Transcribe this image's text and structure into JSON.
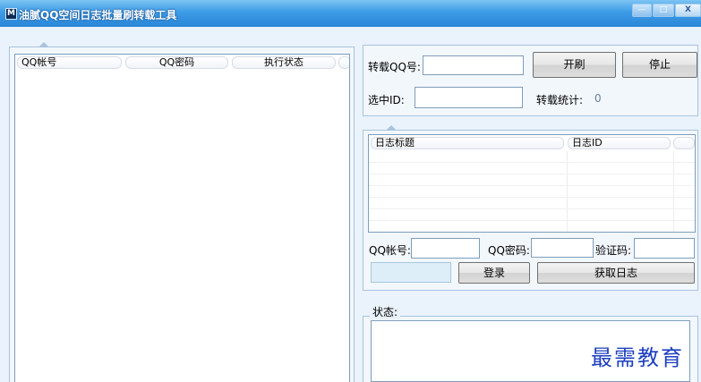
{
  "window": {
    "title": "油腻QQ空间日志批量刷转载工具",
    "app_icon": "M",
    "minimize_glyph": "—",
    "maximize_glyph": "□",
    "close_glyph": "X"
  },
  "accounts_list": {
    "columns": [
      "QQ帐号",
      "QQ密码",
      "执行状态"
    ]
  },
  "repost": {
    "qq_label": "转载QQ号:",
    "qq_value": "",
    "start_button": "开刷",
    "stop_button": "停止",
    "selected_id_label": "选中ID:",
    "selected_id_value": "",
    "stats_label": "转载统计:",
    "stats_value": "0"
  },
  "diary_list": {
    "columns": [
      "日志标题",
      "日志ID"
    ]
  },
  "login": {
    "qq_label": "QQ帐号:",
    "password_label": "QQ密码:",
    "captcha_label": "验证码:",
    "login_button": "登录",
    "fetch_button": "获取日志"
  },
  "status": {
    "label": "状态:"
  },
  "watermark": "最需教育"
}
